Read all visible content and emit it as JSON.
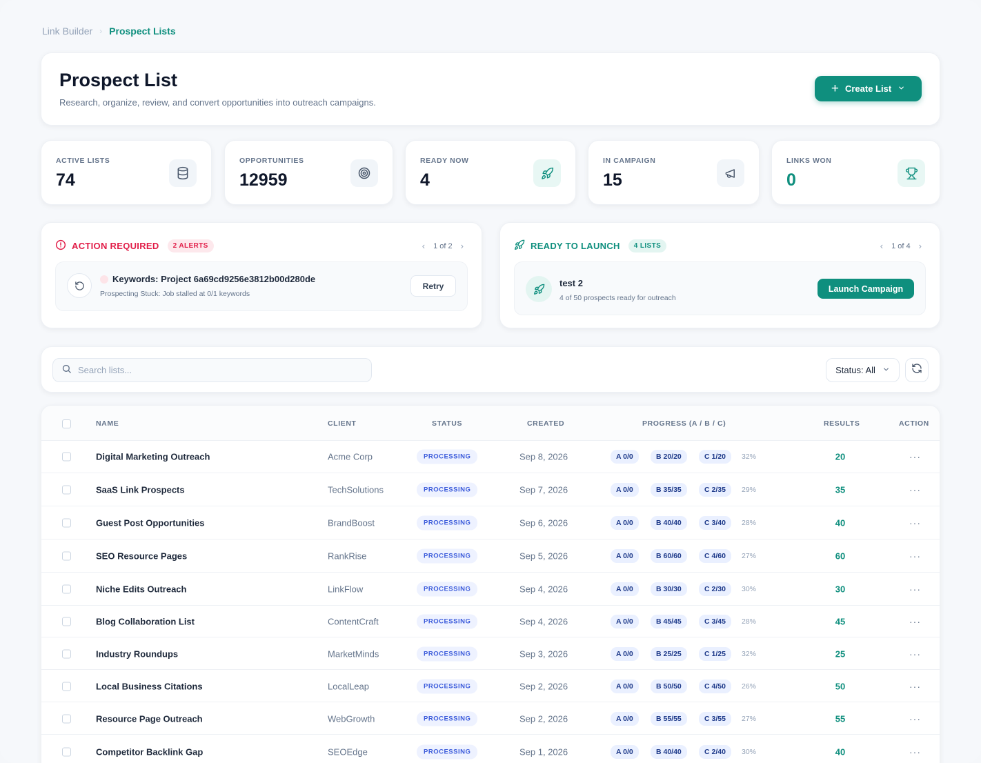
{
  "breadcrumb": {
    "root": "Link Builder",
    "separator": "›",
    "current": "Prospect Lists"
  },
  "header": {
    "title": "Prospect List",
    "subtitle": "Research, organize, review, and convert opportunities into outreach campaigns.",
    "create_label": "Create List"
  },
  "stats": [
    {
      "label": "ACTIVE LISTS",
      "value": "74",
      "icon": "database-icon"
    },
    {
      "label": "OPPORTUNITIES",
      "value": "12959",
      "icon": "target-icon"
    },
    {
      "label": "READY NOW",
      "value": "4",
      "icon": "rocket-icon"
    },
    {
      "label": "IN CAMPAIGN",
      "value": "15",
      "icon": "megaphone-icon"
    },
    {
      "label": "LINKS WON",
      "value": "0",
      "icon": "trophy-icon"
    }
  ],
  "alerts": {
    "title": "ACTION REQUIRED",
    "count": "2 ALERTS",
    "pager": "1 of 2",
    "item": {
      "title": "Keywords: Project 6a69cd9256e3812b00d280de",
      "subtitle": "Prospecting Stuck: Job stalled at 0/1 keywords",
      "action": "Retry"
    }
  },
  "launch": {
    "title": "READY TO LAUNCH",
    "count": "4 LISTS",
    "pager": "1 of 4",
    "item": {
      "title": "test 2",
      "subtitle": "4 of 50 prospects ready for outreach",
      "action": "Launch Campaign"
    }
  },
  "filters": {
    "search_placeholder": "Search lists...",
    "status_label": "Status: All"
  },
  "table": {
    "columns": [
      "NAME",
      "CLIENT",
      "STATUS",
      "CREATED",
      "PROGRESS (A / B / C)",
      "RESULTS",
      "ACTION"
    ],
    "rows": [
      {
        "name": "Digital Marketing Outreach",
        "client": "Acme Corp",
        "status": "PROCESSING",
        "created": "Sep 8, 2026",
        "a": "A 0/0",
        "b": "B 20/20",
        "c": "C 1/20",
        "pct": "32%",
        "results": "20"
      },
      {
        "name": "SaaS Link Prospects",
        "client": "TechSolutions",
        "status": "PROCESSING",
        "created": "Sep 7, 2026",
        "a": "A 0/0",
        "b": "B 35/35",
        "c": "C 2/35",
        "pct": "29%",
        "results": "35"
      },
      {
        "name": "Guest Post Opportunities",
        "client": "BrandBoost",
        "status": "PROCESSING",
        "created": "Sep 6, 2026",
        "a": "A 0/0",
        "b": "B 40/40",
        "c": "C 3/40",
        "pct": "28%",
        "results": "40"
      },
      {
        "name": "SEO Resource Pages",
        "client": "RankRise",
        "status": "PROCESSING",
        "created": "Sep 5, 2026",
        "a": "A 0/0",
        "b": "B 60/60",
        "c": "C 4/60",
        "pct": "27%",
        "results": "60"
      },
      {
        "name": "Niche Edits Outreach",
        "client": "LinkFlow",
        "status": "PROCESSING",
        "created": "Sep 4, 2026",
        "a": "A 0/0",
        "b": "B 30/30",
        "c": "C 2/30",
        "pct": "30%",
        "results": "30"
      },
      {
        "name": "Blog Collaboration List",
        "client": "ContentCraft",
        "status": "PROCESSING",
        "created": "Sep 4, 2026",
        "a": "A 0/0",
        "b": "B 45/45",
        "c": "C 3/45",
        "pct": "28%",
        "results": "45"
      },
      {
        "name": "Industry Roundups",
        "client": "MarketMinds",
        "status": "PROCESSING",
        "created": "Sep 3, 2026",
        "a": "A 0/0",
        "b": "B 25/25",
        "c": "C 1/25",
        "pct": "32%",
        "results": "25"
      },
      {
        "name": "Local Business Citations",
        "client": "LocalLeap",
        "status": "PROCESSING",
        "created": "Sep 2, 2026",
        "a": "A 0/0",
        "b": "B 50/50",
        "c": "C 4/50",
        "pct": "26%",
        "results": "50"
      },
      {
        "name": "Resource Page Outreach",
        "client": "WebGrowth",
        "status": "PROCESSING",
        "created": "Sep 2, 2026",
        "a": "A 0/0",
        "b": "B 55/55",
        "c": "C 3/55",
        "pct": "27%",
        "results": "55"
      },
      {
        "name": "Competitor Backlink Gap",
        "client": "SEOEdge",
        "status": "PROCESSING",
        "created": "Sep 1, 2026",
        "a": "A 0/0",
        "b": "B 40/40",
        "c": "C 2/40",
        "pct": "30%",
        "results": "40"
      }
    ]
  },
  "colors": {
    "accent": "#0f8f7e",
    "alert": "#e11d48",
    "status_badge": "#3b5bdb",
    "background": "#f6f8fb"
  }
}
